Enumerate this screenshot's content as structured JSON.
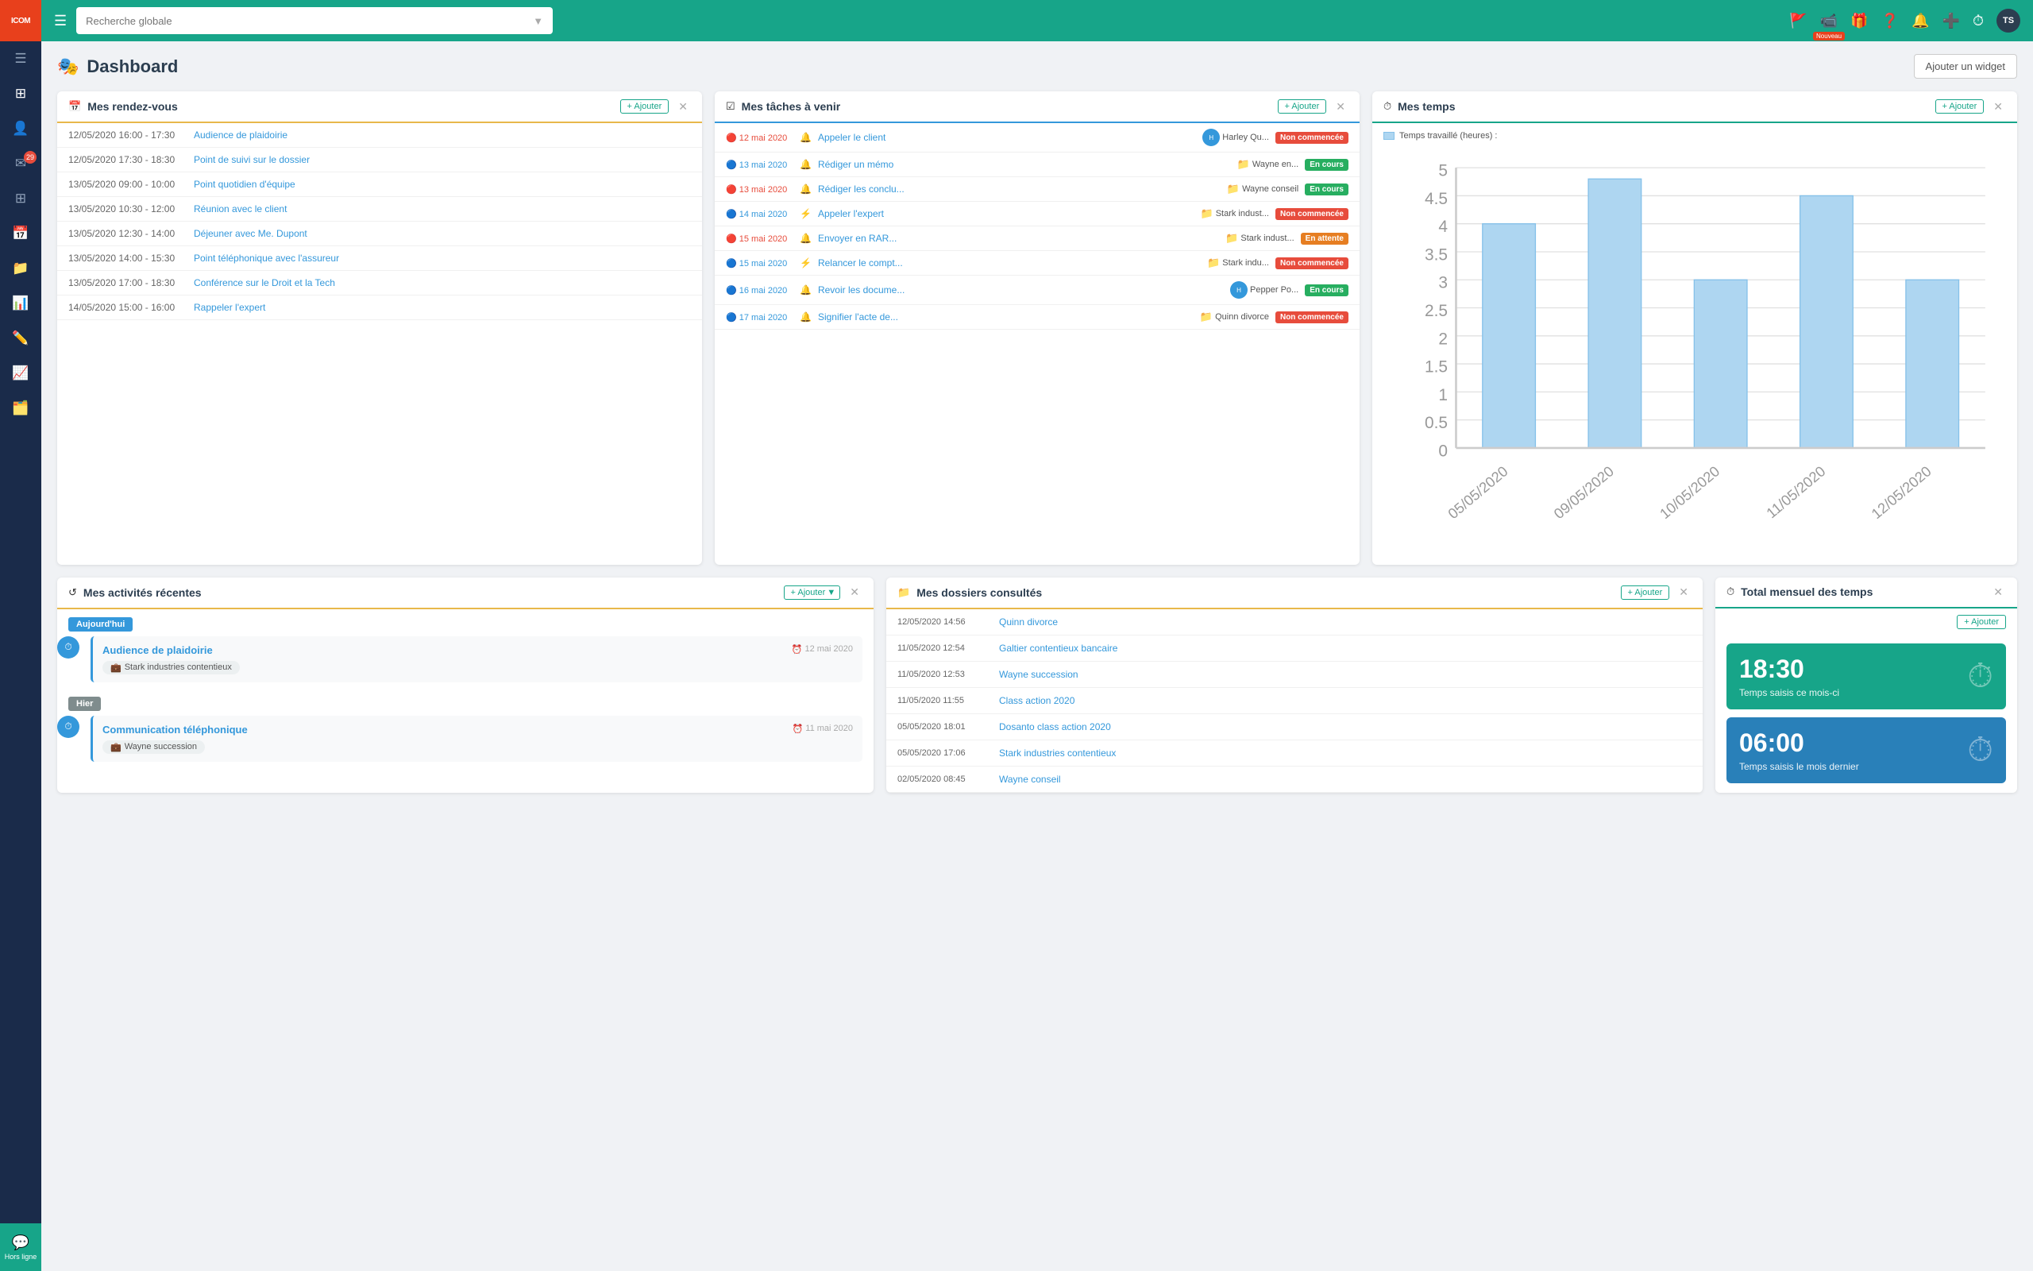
{
  "app": {
    "title": "Dashboard",
    "add_widget_label": "Ajouter un widget",
    "logo_text": "ICOM"
  },
  "topbar": {
    "search_placeholder": "Recherche globale",
    "nouveau_label": "Nouveau",
    "avatar_initials": "TS"
  },
  "sidebar": {
    "chat_label": "Hors ligne",
    "notification_count": "29"
  },
  "widgets": {
    "rendez_vous": {
      "title": "Mes rendez-vous",
      "add_label": "+ Ajouter",
      "items": [
        {
          "time": "12/05/2020 16:00 - 17:30",
          "event": "Audience de plaidoirie"
        },
        {
          "time": "12/05/2020 17:30 - 18:30",
          "event": "Point de suivi sur le dossier"
        },
        {
          "time": "13/05/2020 09:00 - 10:00",
          "event": "Point quotidien d'équipe"
        },
        {
          "time": "13/05/2020 10:30 - 12:00",
          "event": "Réunion avec le client"
        },
        {
          "time": "13/05/2020 12:30 - 14:00",
          "event": "Déjeuner avec Me. Dupont"
        },
        {
          "time": "13/05/2020 14:00 - 15:30",
          "event": "Point téléphonique avec l'assureur"
        },
        {
          "time": "13/05/2020 17:00 - 18:30",
          "event": "Conférence sur le Droit et la Tech"
        },
        {
          "time": "14/05/2020 15:00 - 16:00",
          "event": "Rappeler l'expert"
        }
      ]
    },
    "taches": {
      "title": "Mes tâches à venir",
      "add_label": "+ Ajouter",
      "items": [
        {
          "date": "12 mai 2020",
          "urgent": true,
          "icon": "bell",
          "name": "Appeler le client",
          "assignee": "Harley Qu...",
          "status": "Non commencée",
          "status_type": "not-started"
        },
        {
          "date": "13 mai 2020",
          "urgent": false,
          "icon": "bell",
          "name": "Rédiger un mémo",
          "assignee": "Wayne en...",
          "status": "En cours",
          "status_type": "in-progress"
        },
        {
          "date": "13 mai 2020",
          "urgent": true,
          "icon": "bell",
          "name": "Rédiger les conclu...",
          "assignee": "Wayne conseil",
          "status": "En cours",
          "status_type": "in-progress"
        },
        {
          "date": "14 mai 2020",
          "urgent": false,
          "icon": "lightning",
          "name": "Appeler l'expert",
          "assignee": "Stark indust...",
          "status": "Non commencée",
          "status_type": "not-started"
        },
        {
          "date": "15 mai 2020",
          "urgent": true,
          "icon": "bell",
          "name": "Envoyer en RAR...",
          "assignee": "Stark indust...",
          "status": "En attente",
          "status_type": "waiting"
        },
        {
          "date": "15 mai 2020",
          "urgent": false,
          "icon": "lightning",
          "name": "Relancer le compt...",
          "assignee": "Stark indu...",
          "status": "Non commencée",
          "status_type": "not-started"
        },
        {
          "date": "16 mai 2020",
          "urgent": false,
          "icon": "bell",
          "name": "Revoir les docume...",
          "assignee": "Pepper Po...",
          "status": "En cours",
          "status_type": "in-progress"
        },
        {
          "date": "17 mai 2020",
          "urgent": false,
          "icon": "bell",
          "name": "Signifier l'acte de...",
          "assignee": "Quinn divorce",
          "status": "Non commencée",
          "status_type": "not-started"
        }
      ]
    },
    "temps": {
      "title": "Mes temps",
      "add_label": "+ Ajouter",
      "legend": "Temps travaillé (heures) :",
      "chart": {
        "labels": [
          "05/05/2020",
          "09/05/2020",
          "10/05/2020",
          "11/05/2020",
          "12/05/2020"
        ],
        "values": [
          4.0,
          4.8,
          3.0,
          4.5,
          3.0
        ],
        "max": 5.0,
        "y_ticks": [
          0,
          0.5,
          1.0,
          1.5,
          2.0,
          2.5,
          3.0,
          3.5,
          4.0,
          4.5,
          5.0
        ]
      }
    },
    "activites": {
      "title": "Mes activités récentes",
      "add_label": "+ Ajouter",
      "today_label": "Aujourd'hui",
      "hier_label": "Hier",
      "items_today": [
        {
          "title": "Audience de plaidoirie",
          "time": "12 mai 2020",
          "sub": "Stark industries contentieux"
        }
      ],
      "items_hier": [
        {
          "title": "Communication téléphonique",
          "time": "11 mai 2020",
          "sub": "Wayne succession"
        }
      ]
    },
    "dossiers": {
      "title": "Mes dossiers consultés",
      "add_label": "+ Ajouter",
      "items": [
        {
          "time": "12/05/2020 14:56",
          "name": "Quinn divorce"
        },
        {
          "time": "11/05/2020 12:54",
          "name": "Galtier contentieux bancaire"
        },
        {
          "time": "11/05/2020 12:53",
          "name": "Wayne succession"
        },
        {
          "time": "11/05/2020 11:55",
          "name": "Class action 2020"
        },
        {
          "time": "05/05/2020 18:01",
          "name": "Dosanto class action 2020"
        },
        {
          "time": "05/05/2020 17:06",
          "name": "Stark industries contentieux"
        },
        {
          "time": "02/05/2020 08:45",
          "name": "Wayne conseil"
        }
      ]
    },
    "total_temps": {
      "title": "Total mensuel des temps",
      "add_label": "+ Ajouter",
      "current_time": "18:30",
      "current_label": "Temps saisis ce mois-ci",
      "last_time": "06:00",
      "last_label": "Temps saisis le mois dernier"
    }
  }
}
